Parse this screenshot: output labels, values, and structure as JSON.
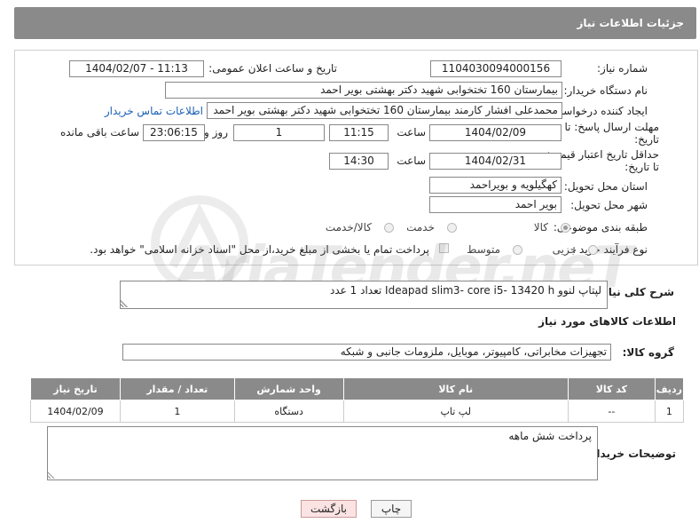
{
  "header": {
    "title": "جزئیات اطلاعات نیاز"
  },
  "form": {
    "need_number_label": "شماره نیاز:",
    "need_number": "1104030094000156",
    "announce_label": "تاریخ و ساعت اعلان عمومی:",
    "announce_value": "1404/02/07 - 11:13",
    "buyer_org_label": "نام دستگاه خریدار:",
    "buyer_org": "بیمارستان 160 تختخوابی شهید دکتر بهشتی بویر احمد",
    "requester_label": "ایجاد کننده درخواست:",
    "requester": "محمدعلی افشار کارمند بیمارستان 160 تختخوابی شهید دکتر بهشتی بویر احمد",
    "contact_link": "اطلاعات تماس خریدار",
    "deadline_label_1": "مهلت ارسال پاسخ: تا",
    "deadline_label_2": "تاریخ:",
    "deadline_date": "1404/02/09",
    "time_label": "ساعت",
    "deadline_time": "11:15",
    "days_value": "1",
    "days_label": "روز و",
    "remaining_time": "23:06:15",
    "remaining_label": "ساعت باقی مانده",
    "min_validity_label_1": "حداقل تاریخ اعتبار قیمت:",
    "min_validity_label_2": "تا تاریخ:",
    "validity_date": "1404/02/31",
    "validity_time": "14:30",
    "province_label": "استان محل تحویل:",
    "province": "کهگیلویه و بویراحمد",
    "city_label": "شهر محل تحویل:",
    "city": "بویر احمد",
    "category_label": "طبقه بندی موضوعی:",
    "category_options": [
      "کالا",
      "خدمت",
      "کالا/خدمت"
    ],
    "process_label": "نوع فرآیند خرید :",
    "process_options": [
      "جزیی",
      "متوسط"
    ],
    "payment_note": "پرداخت تمام یا بخشی از مبلغ خرید،از محل \"اسناد خزانه اسلامی\" خواهد بود."
  },
  "description": {
    "label": "شرح کلی نیاز:",
    "text": "لپتاپ لنوو  Ideapad slim3- core i5- 13420 h  تعداد 1 عدد"
  },
  "goods_info_title": "اطلاعات کالاهای مورد نیاز",
  "goods_group": {
    "label": "گروه کالا:",
    "value": "تجهیزات مخابراتی، کامپیوتر، موبایل، ملزومات جانبی و شبکه"
  },
  "table": {
    "headers": [
      "ردیف",
      "کد کالا",
      "نام کالا",
      "واحد شمارش",
      "تعداد / مقدار",
      "تاریخ نیاز"
    ],
    "rows": [
      [
        "1",
        "--",
        "لپ تاپ",
        "دستگاه",
        "1",
        "1404/02/09"
      ]
    ]
  },
  "buyer_notes": {
    "label": "توضیحات خریدار:",
    "text": "پرداخت شش ماهه"
  },
  "buttons": {
    "print": "چاپ",
    "back": "بازگشت"
  },
  "watermark": "AriaTender.neT"
}
